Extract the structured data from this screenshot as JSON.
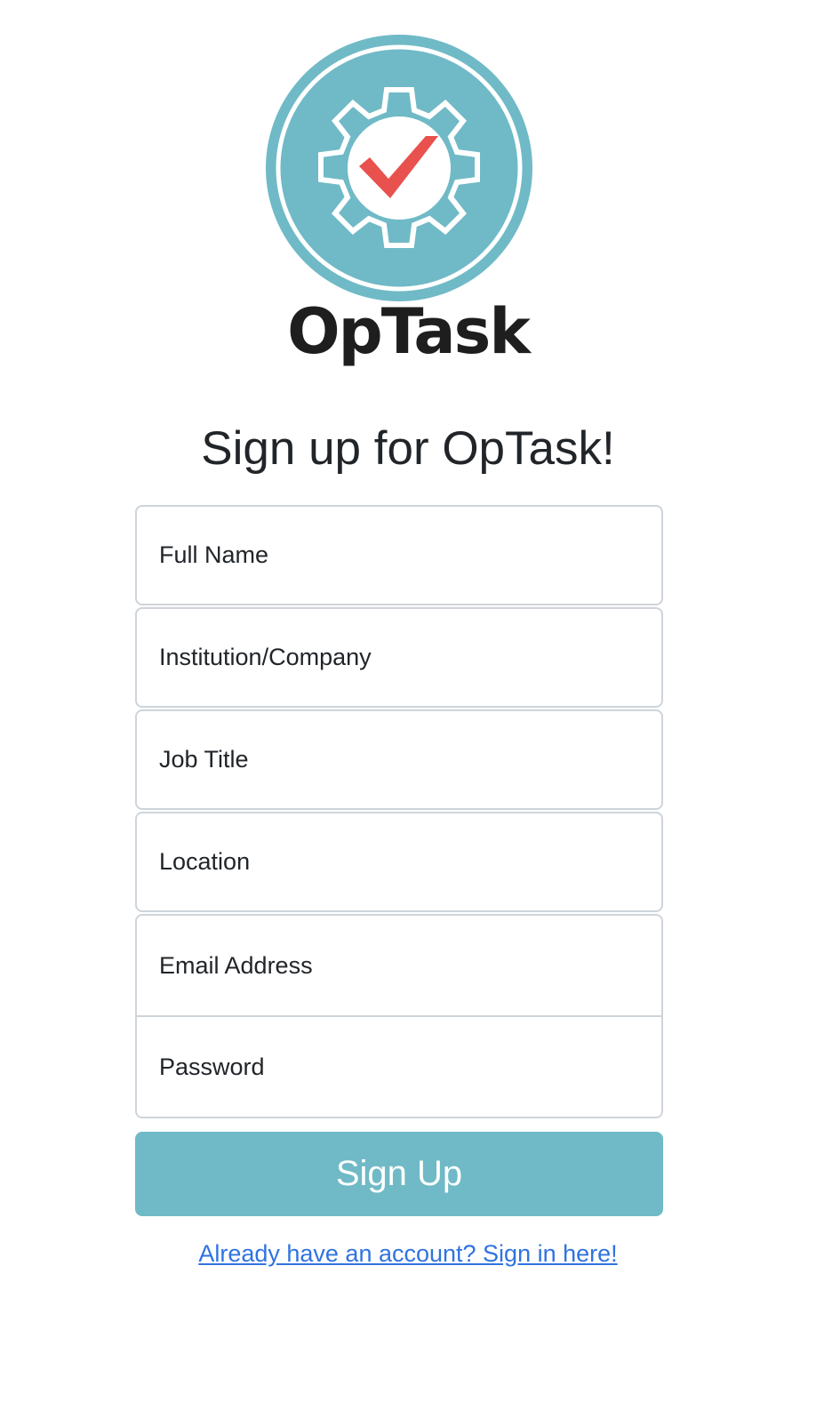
{
  "brand": {
    "logo_text": "OpTask",
    "colors": {
      "accent": "#6fbac6",
      "check": "#e8514e",
      "wordmark": "#1e1e1e"
    },
    "icon": "gear-check-icon"
  },
  "page": {
    "title": "Sign up for OpTask!"
  },
  "form": {
    "fields": {
      "full_name": {
        "placeholder": "Full Name",
        "value": ""
      },
      "institution": {
        "placeholder": "Institution/Company",
        "value": ""
      },
      "job_title": {
        "placeholder": "Job Title",
        "value": ""
      },
      "location": {
        "placeholder": "Location",
        "value": ""
      },
      "email": {
        "placeholder": "Email Address",
        "value": ""
      },
      "password": {
        "placeholder": "Password",
        "value": ""
      }
    },
    "submit_label": "Sign Up",
    "signin_link_text": "Already have an account? Sign in here!"
  }
}
